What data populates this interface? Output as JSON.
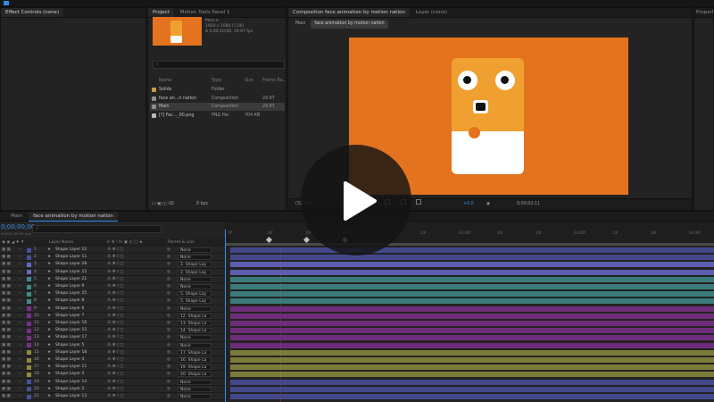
{
  "panels": {
    "effect_controls": "Effect Controls (none)",
    "project": "Project",
    "motion_tools": "Motion Tools Panel 1",
    "composition": "Composition face animation by motion nation",
    "layer": "Layer (none)",
    "properties": "Propert"
  },
  "project": {
    "item_name": "Main ▾",
    "item_info": [
      "1920 x 1080 (1.00)",
      "Δ 0;00;10;00, 29.97 fps"
    ],
    "search_placeholder": "⌕",
    "columns": [
      "Name",
      "Type",
      "Size",
      "Frame Ra..."
    ],
    "items": [
      {
        "name": "Solids",
        "type": "Folder",
        "size": "",
        "fps": "",
        "color": "#c8a040"
      },
      {
        "name": "face an...n nation",
        "type": "Composition",
        "size": "",
        "fps": "29.97",
        "color": "#8c8c8c"
      },
      {
        "name": "Main",
        "type": "Composition",
        "size": "",
        "fps": "29.97",
        "color": "#8c8c8c"
      },
      {
        "name": "[?] Fac..._00.png",
        "type": "PNG file",
        "size": "704 KB",
        "fps": "",
        "color": "#bbbbbb"
      }
    ],
    "bpc": "8 bpc"
  },
  "composition": {
    "flow": [
      "Main",
      "face animation by motion nation"
    ],
    "zoom": "(32.3%)",
    "res_value": "+0.0",
    "timecode": "0;00;02;11",
    "colors": {
      "background": "#e4731f",
      "face": "#f0a030",
      "chin": "#ffffff",
      "nose": "#e4731f"
    }
  },
  "timeline": {
    "tabs": [
      "Main",
      "face animation by motion nation"
    ],
    "timecode": "0;00;00;00",
    "fps": "00000 (29.97 fps)",
    "search_placeholder": "⌕",
    "header": {
      "layer_name": "Layer Name",
      "parent": "Parent & Link"
    },
    "ruler": [
      "0f",
      "10f",
      "20f",
      "01:00f",
      "10f",
      "20f",
      "02:00f",
      "10f",
      "20f",
      "03:00f",
      "10f",
      "20f",
      "04:00f",
      "10f"
    ],
    "layers": [
      {
        "num": "1",
        "name": "Shape Layer 22",
        "parent": "None",
        "color": "#4a4f9e"
      },
      {
        "num": "2",
        "name": "Shape Layer 11",
        "parent": "None",
        "color": "#4a4f9e"
      },
      {
        "num": "3",
        "name": "Shape Layer 28",
        "parent": "2. Shape Lay",
        "color": "#6767c8"
      },
      {
        "num": "4",
        "name": "Shape Layer 12",
        "parent": "2. Shape Lay",
        "color": "#6767c8"
      },
      {
        "num": "5",
        "name": "Shape Layer 21",
        "parent": "None",
        "color": "#3e8a8a"
      },
      {
        "num": "6",
        "name": "Shape Layer 9",
        "parent": "None",
        "color": "#3e8a8a"
      },
      {
        "num": "7",
        "name": "Shape Layer 25",
        "parent": "5. Shape Lay",
        "color": "#3e8a8a"
      },
      {
        "num": "8",
        "name": "Shape Layer 8",
        "parent": "5. Shape Lay",
        "color": "#3e8a8a"
      },
      {
        "num": "9",
        "name": "Shape Layer 6",
        "parent": "None",
        "color": "#7a2f8a"
      },
      {
        "num": "10",
        "name": "Shape Layer 7",
        "parent": "12. Shape La",
        "color": "#7a2f8a"
      },
      {
        "num": "11",
        "name": "Shape Layer 16",
        "parent": "13. Shape La",
        "color": "#7a2f8a"
      },
      {
        "num": "12",
        "name": "Shape Layer 15",
        "parent": "14. Shape La",
        "color": "#7a2f8a"
      },
      {
        "num": "13",
        "name": "Shape Layer 17",
        "parent": "None",
        "color": "#7a2f8a"
      },
      {
        "num": "14",
        "name": "Shape Layer 5",
        "parent": "None",
        "color": "#7a2f8a"
      },
      {
        "num": "15",
        "name": "Shape Layer 18",
        "parent": "17. Shape La",
        "color": "#8c8c3e"
      },
      {
        "num": "16",
        "name": "Shape Layer 4",
        "parent": "16. Shape La",
        "color": "#8c8c3e"
      },
      {
        "num": "17",
        "name": "Shape Layer 11",
        "parent": "19. Shape La",
        "color": "#8c8c3e"
      },
      {
        "num": "18",
        "name": "Shape Layer 3",
        "parent": "20. Shape La",
        "color": "#8c8c3e"
      },
      {
        "num": "19",
        "name": "Shape Layer 14",
        "parent": "None",
        "color": "#4a4f9e"
      },
      {
        "num": "20",
        "name": "Shape Layer 2",
        "parent": "None",
        "color": "#4a4f9e"
      },
      {
        "num": "21",
        "name": "Shape Layer 13",
        "parent": "None",
        "color": "#4a4f9e"
      }
    ]
  },
  "player": {
    "icon": "play-icon"
  }
}
